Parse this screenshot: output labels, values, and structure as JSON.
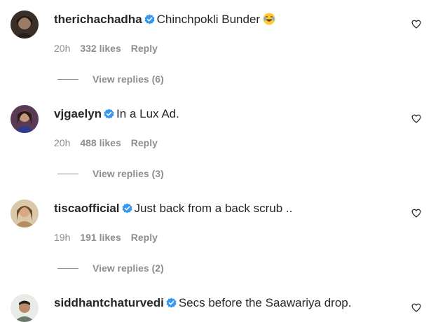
{
  "comments": [
    {
      "username": "therichachadha",
      "text": "Chinchpokli Bunder",
      "emoji": "face-with-tears-of-joy",
      "time": "20h",
      "likes": "332 likes",
      "reply_label": "Reply",
      "view_replies": "View replies (6)"
    },
    {
      "username": "vjgaelyn",
      "text": "In a Lux Ad.",
      "time": "20h",
      "likes": "488 likes",
      "reply_label": "Reply",
      "view_replies": "View replies (3)"
    },
    {
      "username": "tiscaofficial",
      "text": "Just back from a back scrub ..",
      "time": "19h",
      "likes": "191 likes",
      "reply_label": "Reply",
      "view_replies": "View replies (2)"
    },
    {
      "username": "siddhantchaturvedi",
      "text": "Secs before the Saawariya drop."
    }
  ],
  "colors": {
    "text": "#262626",
    "muted": "#8e8e8e",
    "verified": "#3897f0"
  },
  "icons": {
    "verified": "verified-badge-icon",
    "like": "heart-outline-icon"
  }
}
